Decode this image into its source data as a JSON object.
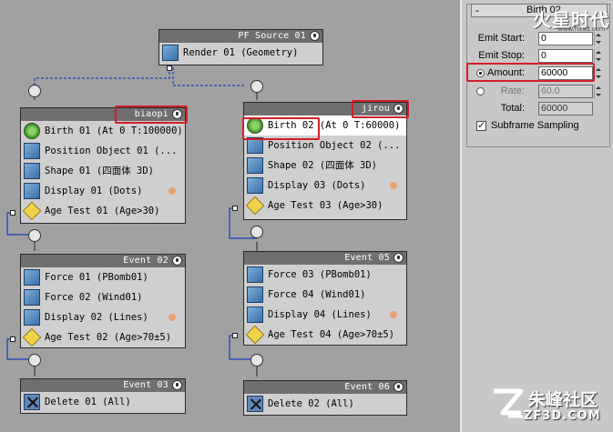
{
  "source_node": {
    "title": "PF Source 01",
    "op": "Render 01 (Geometry)"
  },
  "nodes": {
    "biaopi": {
      "title": "biaopi",
      "ops": [
        "Birth 01 (At 0 T:100000)",
        "Position Object 01 (...",
        "Shape 01 (四面体 3D)",
        "Display 01 (Dots)",
        "Age Test 01 (Age>30)"
      ]
    },
    "jirou": {
      "title": "jirou",
      "ops": [
        "Birth 02 (At 0 T:60000)",
        "Position Object 02 (...",
        "Shape 02 (四面体 3D)",
        "Display 03 (Dots)",
        "Age Test 03 (Age>30)"
      ]
    },
    "event02": {
      "title": "Event 02",
      "ops": [
        "Force 01 (PBomb01)",
        "Force 02 (Wind01)",
        "Display 02 (Lines)",
        "Age Test 02 (Age>70±5)"
      ]
    },
    "event05": {
      "title": "Event 05",
      "ops": [
        "Force 03 (PBomb01)",
        "Force 04 (Wind01)",
        "Display 04 (Lines)",
        "Age Test 04 (Age>70±5)"
      ]
    },
    "event03": {
      "title": "Event 03",
      "ops": [
        "Delete 01 (All)"
      ]
    },
    "event06": {
      "title": "Event 06",
      "ops": [
        "Delete 02 (All)"
      ]
    }
  },
  "panel": {
    "title": "Birth 02",
    "emit_start_label": "Emit Start:",
    "emit_start": "0",
    "emit_stop_label": "Emit Stop:",
    "emit_stop": "0",
    "amount_label": "Amount:",
    "amount": "60000",
    "rate_label": "Rate:",
    "rate": "60.0",
    "total_label": "Total:",
    "total": "60000",
    "subframe_label": "Subframe Sampling"
  },
  "watermark": {
    "top": "火星时代",
    "top_url": "www.hxsd.com",
    "cn": "朱峰社区",
    "en": "ZF3D.COM"
  },
  "colors": {
    "highlight": "#d21f26",
    "node_title": "#6f6f6f",
    "canvas": "#a1a1a1"
  }
}
